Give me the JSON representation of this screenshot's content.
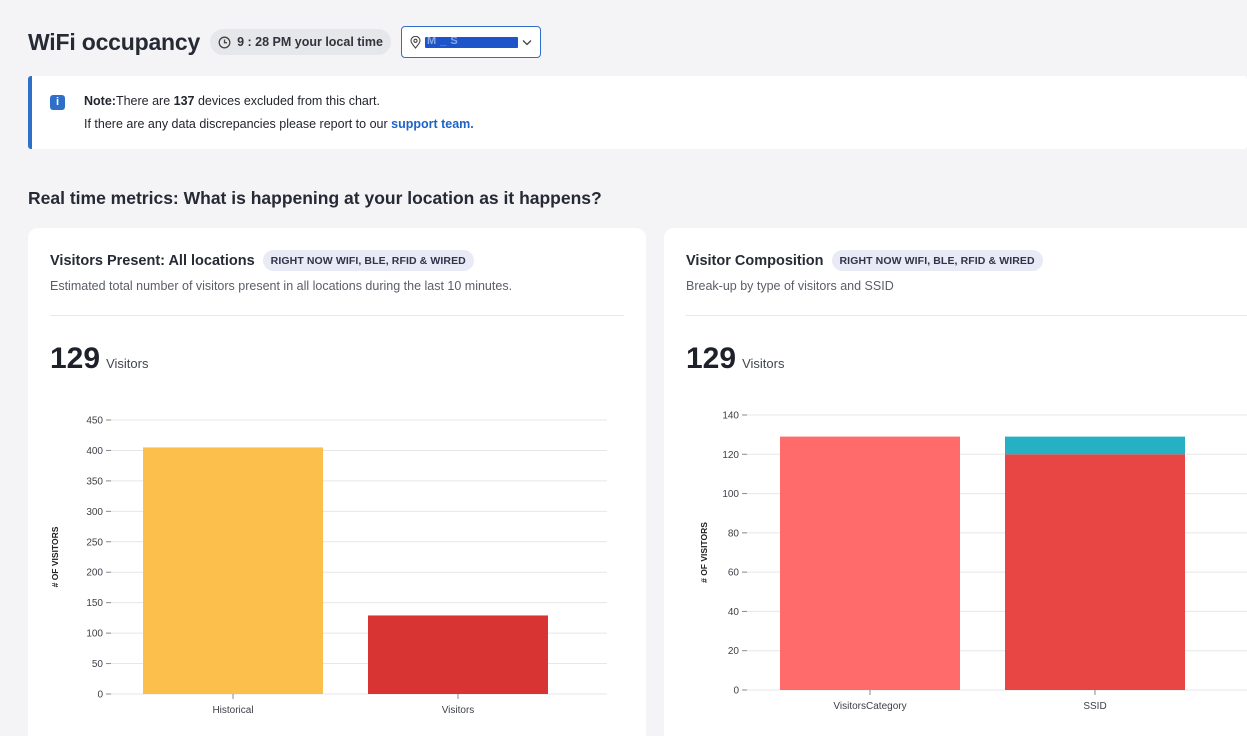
{
  "header": {
    "title": "WiFi occupancy",
    "time": "9 : 28 PM your local time",
    "location_masked": "M    _    S"
  },
  "note": {
    "prefix": "Note:",
    "text_before": "There are ",
    "count": "137",
    "text_after": " devices excluded from this chart.",
    "line2": "If there are any data discrepancies please report to our ",
    "link": "support team."
  },
  "section_title": "Real time metrics: What is happening at your location as it happens?",
  "cards": [
    {
      "title": "Visitors Present: All locations",
      "tag": "RIGHT NOW WIFI, BLE, RFID & WIRED",
      "subtitle": "Estimated total number of visitors present in all locations during the last 10 minutes.",
      "kpi_value": "129",
      "kpi_label": "Visitors"
    },
    {
      "title": "Visitor Composition",
      "tag": "RIGHT NOW WIFI, BLE, RFID & WIRED",
      "subtitle": "Break-up by type of visitors and SSID",
      "kpi_value": "129",
      "kpi_label": "Visitors"
    }
  ],
  "colors": {
    "accent": "#2f6fc9",
    "historical": "#fdbf4c",
    "visitors": "#d93434",
    "category": "#ff6b6b",
    "ssid_main": "#e84545",
    "ssid_secondary": "#25b0c3"
  },
  "chart_data": [
    {
      "type": "bar",
      "categories": [
        "Historical",
        "Visitors"
      ],
      "values": [
        405,
        129
      ],
      "ylabel": "# OF VISITORS",
      "ylim": [
        0,
        450
      ],
      "yticks": [
        0,
        50,
        100,
        150,
        200,
        250,
        300,
        350,
        400,
        450
      ],
      "grid": true
    },
    {
      "type": "bar",
      "stacked": true,
      "categories": [
        "VisitorsCategory",
        "SSID"
      ],
      "series": [
        {
          "values": [
            129,
            120
          ]
        },
        {
          "values": [
            0,
            9
          ]
        }
      ],
      "ylabel": "# OF VISITORS",
      "ylim": [
        0,
        140
      ],
      "yticks": [
        0,
        20,
        40,
        60,
        80,
        100,
        120,
        140
      ],
      "grid": true
    }
  ]
}
